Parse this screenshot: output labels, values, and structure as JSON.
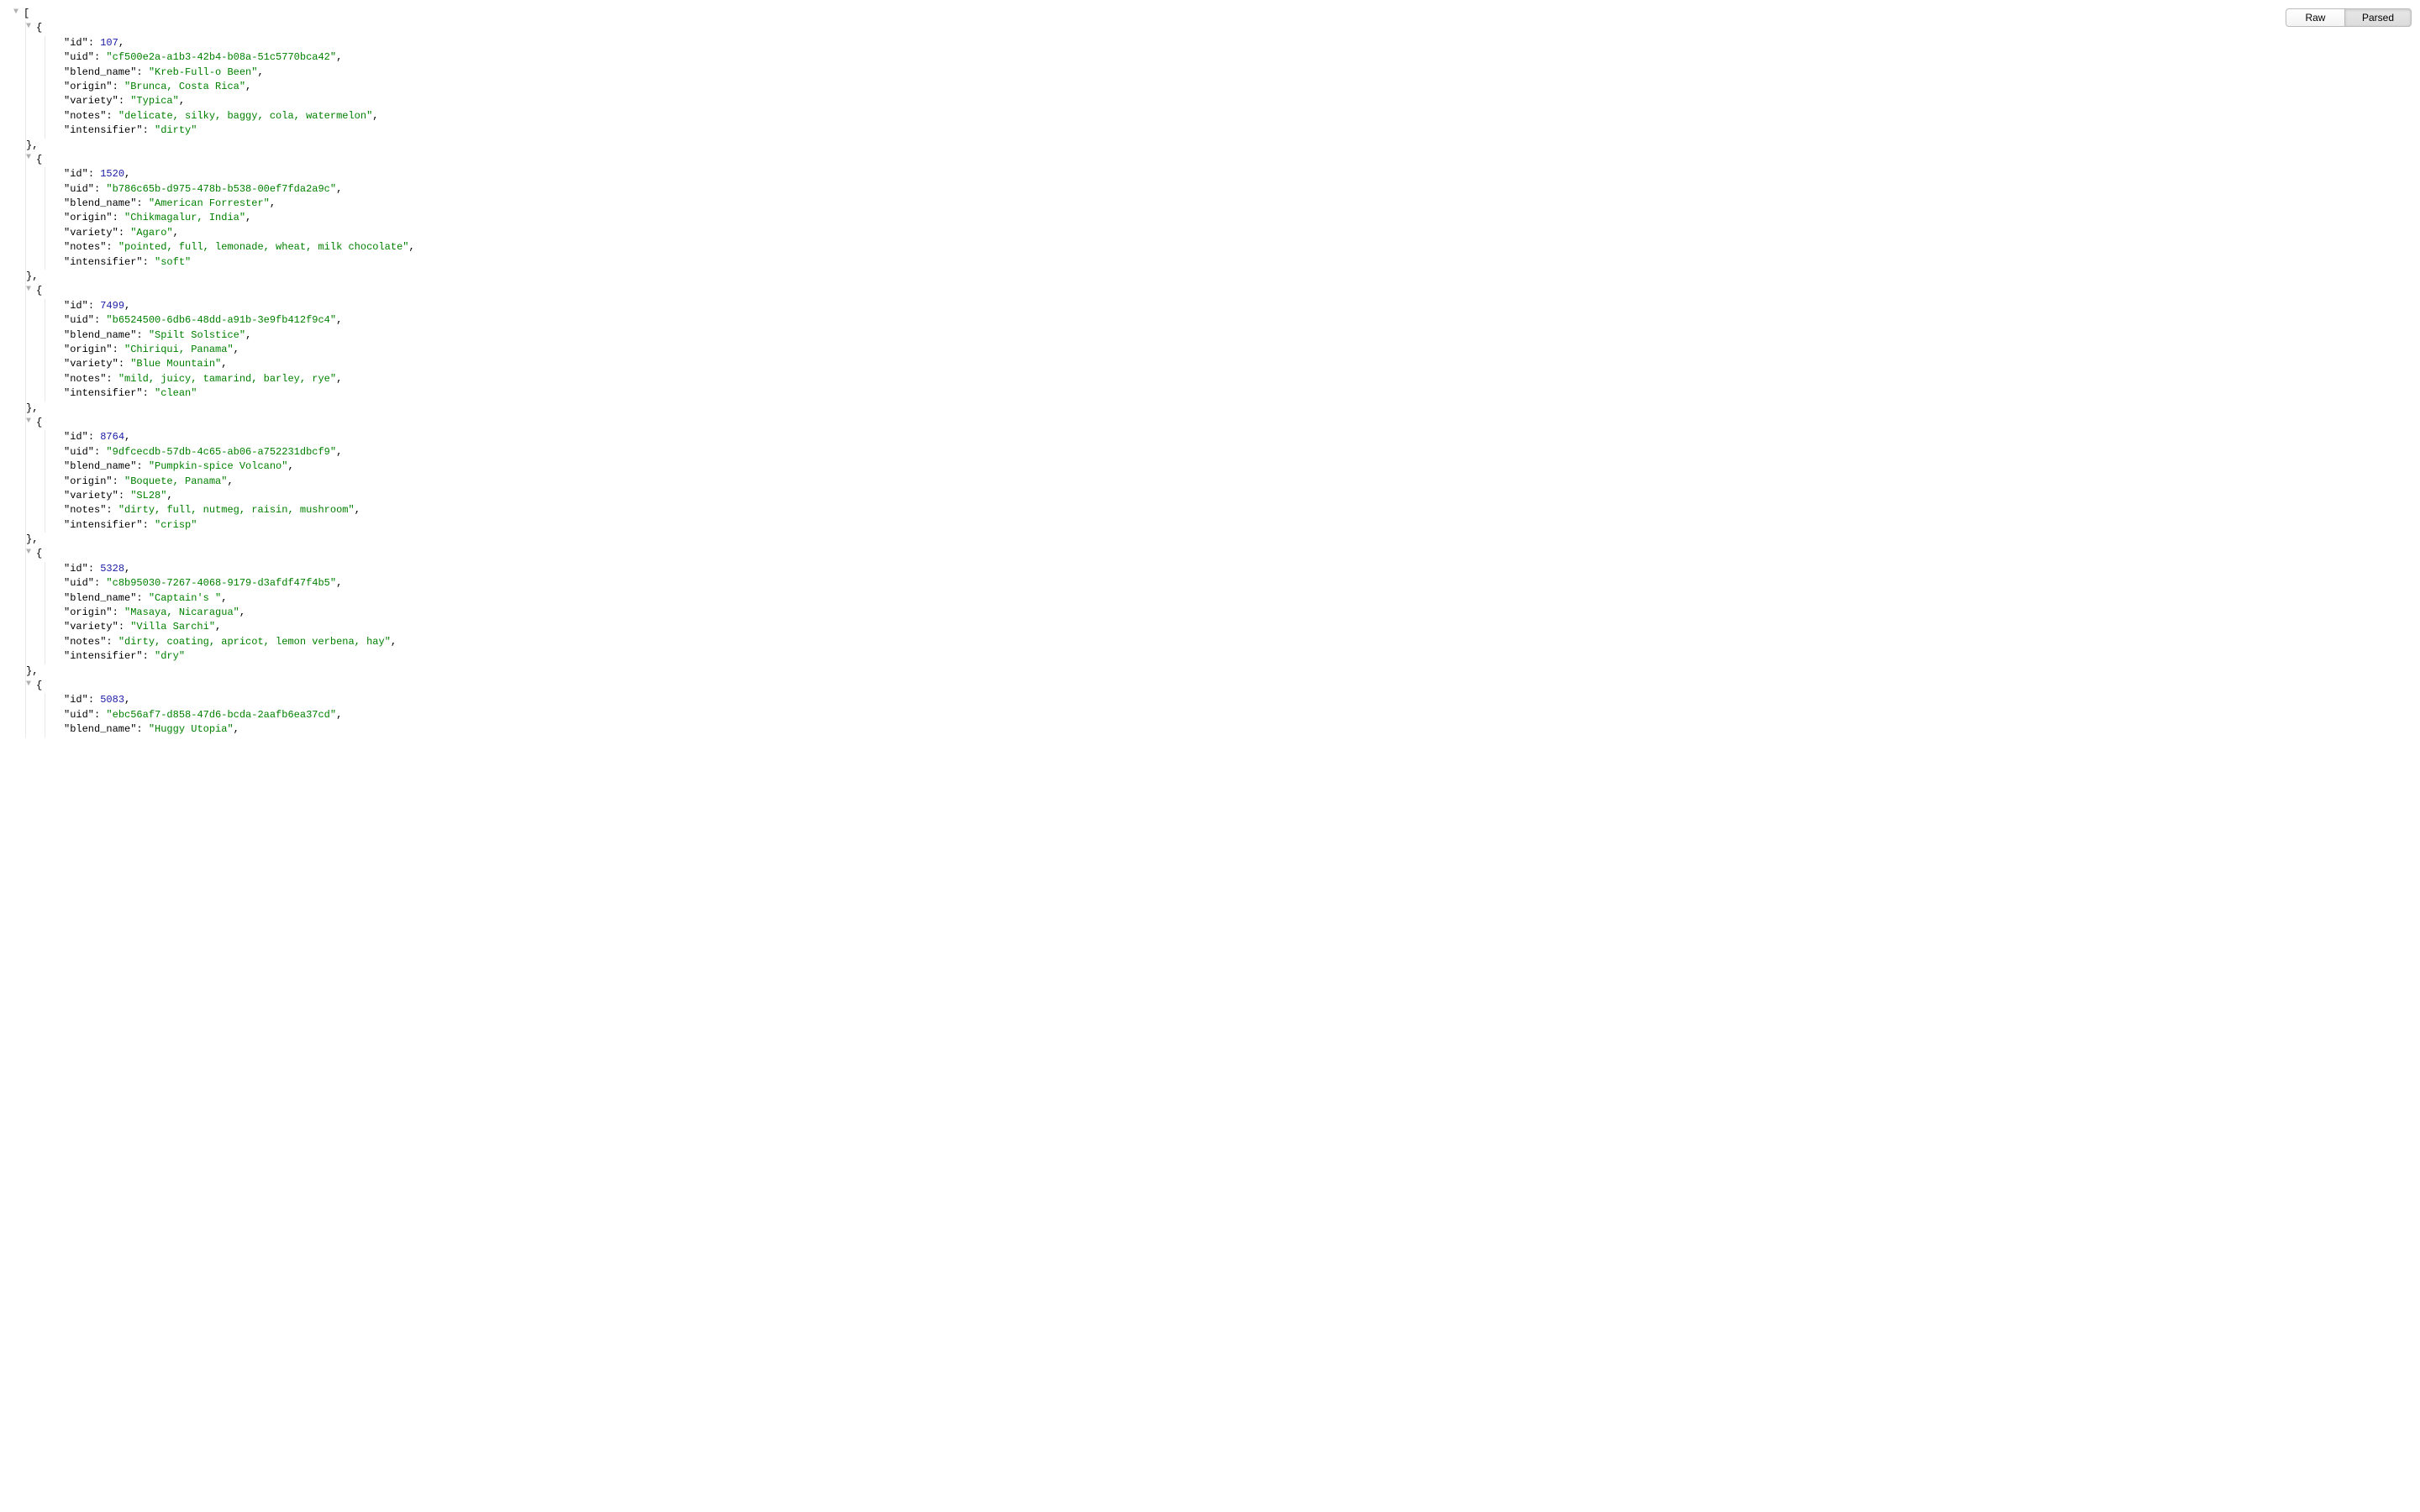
{
  "toolbar": {
    "raw_label": "Raw",
    "parsed_label": "Parsed"
  },
  "items": [
    {
      "id": 107,
      "uid": "cf500e2a-a1b3-42b4-b08a-51c5770bca42",
      "blend_name": "Kreb-Full-o Been",
      "origin": "Brunca, Costa Rica",
      "variety": "Typica",
      "notes": "delicate, silky, baggy, cola, watermelon",
      "intensifier": "dirty"
    },
    {
      "id": 1520,
      "uid": "b786c65b-d975-478b-b538-00ef7fda2a9c",
      "blend_name": "American Forrester",
      "origin": "Chikmagalur, India",
      "variety": "Agaro",
      "notes": "pointed, full, lemonade, wheat, milk chocolate",
      "intensifier": "soft"
    },
    {
      "id": 7499,
      "uid": "b6524500-6db6-48dd-a91b-3e9fb412f9c4",
      "blend_name": "Spilt Solstice",
      "origin": "Chiriqui, Panama",
      "variety": "Blue Mountain",
      "notes": "mild, juicy, tamarind, barley, rye",
      "intensifier": "clean"
    },
    {
      "id": 8764,
      "uid": "9dfcecdb-57db-4c65-ab06-a752231dbcf9",
      "blend_name": "Pumpkin-spice Volcano",
      "origin": "Boquete, Panama",
      "variety": "SL28",
      "notes": "dirty, full, nutmeg, raisin, mushroom",
      "intensifier": "crisp"
    },
    {
      "id": 5328,
      "uid": "c8b95030-7267-4068-9179-d3afdf47f4b5",
      "blend_name": "Captain's ",
      "origin": "Masaya, Nicaragua",
      "variety": "Villa Sarchi",
      "notes": "dirty, coating, apricot, lemon verbena, hay",
      "intensifier": "dry"
    },
    {
      "id": 5083,
      "uid": "ebc56af7-d858-47d6-bcda-2aafb6ea37cd",
      "blend_name": "Huggy Utopia"
    }
  ],
  "last_item_truncated": true
}
